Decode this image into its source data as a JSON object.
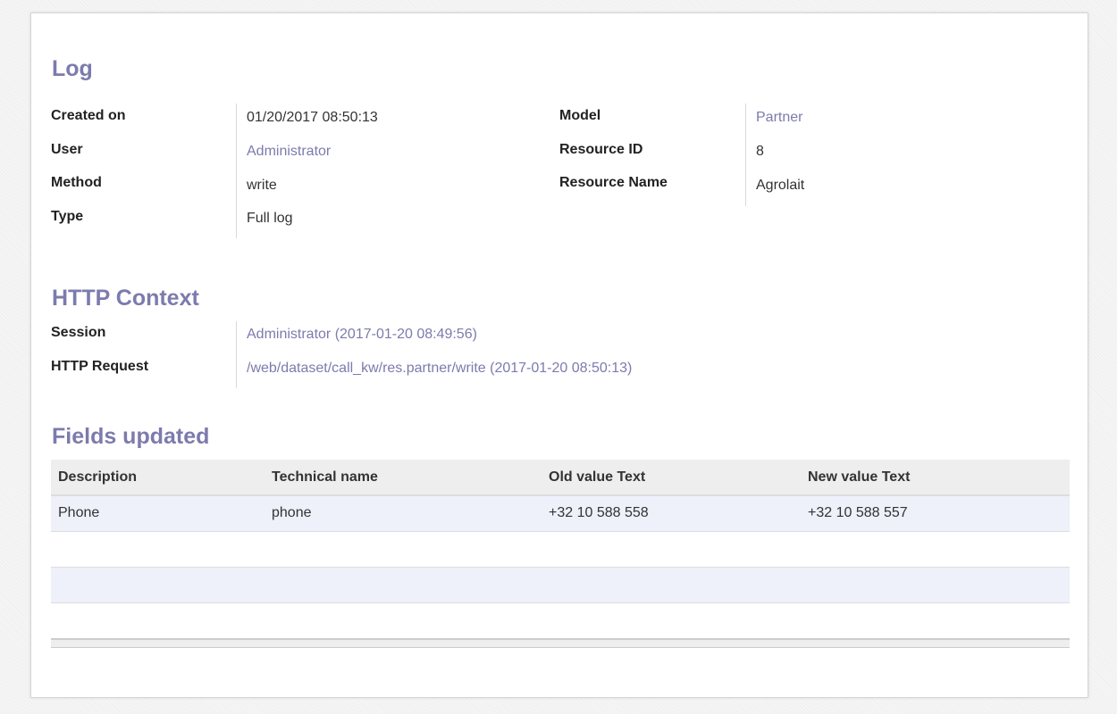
{
  "log": {
    "title": "Log",
    "left": [
      {
        "label": "Created on",
        "value": "01/20/2017 08:50:13"
      },
      {
        "label": "User",
        "value": "Administrator"
      },
      {
        "label": "Method",
        "value": "write"
      },
      {
        "label": "Type",
        "value": "Full log"
      }
    ],
    "right": [
      {
        "label": "Model",
        "value": "Partner"
      },
      {
        "label": "Resource ID",
        "value": "8"
      },
      {
        "label": "Resource Name",
        "value": "Agrolait"
      }
    ]
  },
  "http_context": {
    "title": "HTTP Context",
    "rows": [
      {
        "label": "Session",
        "value": "Administrator (2017-01-20 08:49:56)"
      },
      {
        "label": "HTTP Request",
        "value": "/web/dataset/call_kw/res.partner/write (2017-01-20 08:50:13)"
      }
    ]
  },
  "fields_updated": {
    "title": "Fields updated",
    "columns": [
      "Description",
      "Technical name",
      "Old value Text",
      "New value Text"
    ],
    "rows": [
      [
        "Phone",
        "phone",
        "+32 10 588 558",
        "+32 10 588 557"
      ]
    ]
  },
  "colors": {
    "accent": "#7c7bad",
    "row_highlight": "#eef0fa",
    "header_bg": "#eeeeee"
  }
}
